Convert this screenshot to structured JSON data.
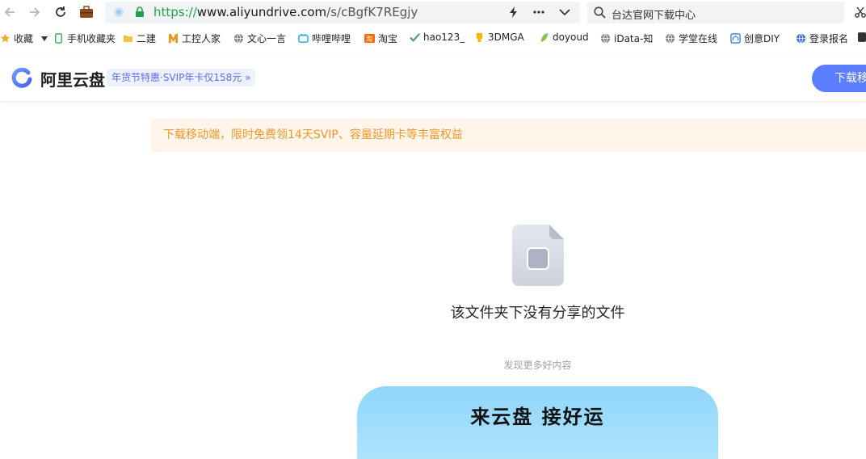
{
  "browser": {
    "url_scheme": "https://",
    "url_host": "www.aliyundrive.com",
    "url_path": "/s/cBgfK7REgjy",
    "search_text": "台达官网下载中心"
  },
  "bookmarks": [
    {
      "label": "收藏"
    },
    {
      "label": "手机收藏夹"
    },
    {
      "label": "二建"
    },
    {
      "label": "工控人家"
    },
    {
      "label": "文心一言"
    },
    {
      "label": "哔哩哔哩"
    },
    {
      "label": "淘宝"
    },
    {
      "label": "hao123_"
    },
    {
      "label": "3DMGA"
    },
    {
      "label": "doyoud"
    },
    {
      "label": "iData-知"
    },
    {
      "label": "学堂在线"
    },
    {
      "label": "创意DIY"
    },
    {
      "label": "登录报名"
    }
  ],
  "app": {
    "logo": "阿里云盘",
    "promo": "年货节特惠·SVIP年卡仅158元 »",
    "download_button": "下载移动端"
  },
  "notice": "下载移动端，限时免费领14天SVIP、容量延期卡等丰富权益",
  "empty": {
    "message": "该文件夹下没有分享的文件",
    "discover": "发现更多好内容"
  },
  "banner": {
    "title": "来云盘 接好运"
  },
  "colors": {
    "accent": "#5b7dff",
    "notice_bg": "#fff5ea",
    "notice_text": "#f3962a",
    "url_scheme": "#22a04b"
  }
}
